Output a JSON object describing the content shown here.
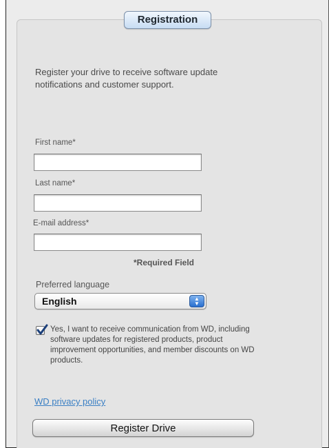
{
  "panel": {
    "title": "Registration"
  },
  "intro_text": "Register your drive to receive software update notifications and customer support.",
  "form": {
    "first_name": {
      "label": "First name*",
      "value": ""
    },
    "last_name": {
      "label": "Last name*",
      "value": ""
    },
    "email": {
      "label": "E-mail address*",
      "value": ""
    },
    "required_note": "*Required Field",
    "language": {
      "label": "Preferred language",
      "selected": "English"
    },
    "consent": {
      "checked": true,
      "text": "Yes, I want to receive communication from WD, including software updates for registered products, product improvement opportunities, and member discounts on WD products."
    },
    "privacy_link": "WD privacy policy",
    "submit_label": "Register Drive"
  },
  "colors": {
    "link": "#3a7fc4",
    "accent": "#2a6fcf"
  },
  "icons": {
    "checkbox": "checkmark-icon",
    "select": "up-down-arrows-icon"
  }
}
